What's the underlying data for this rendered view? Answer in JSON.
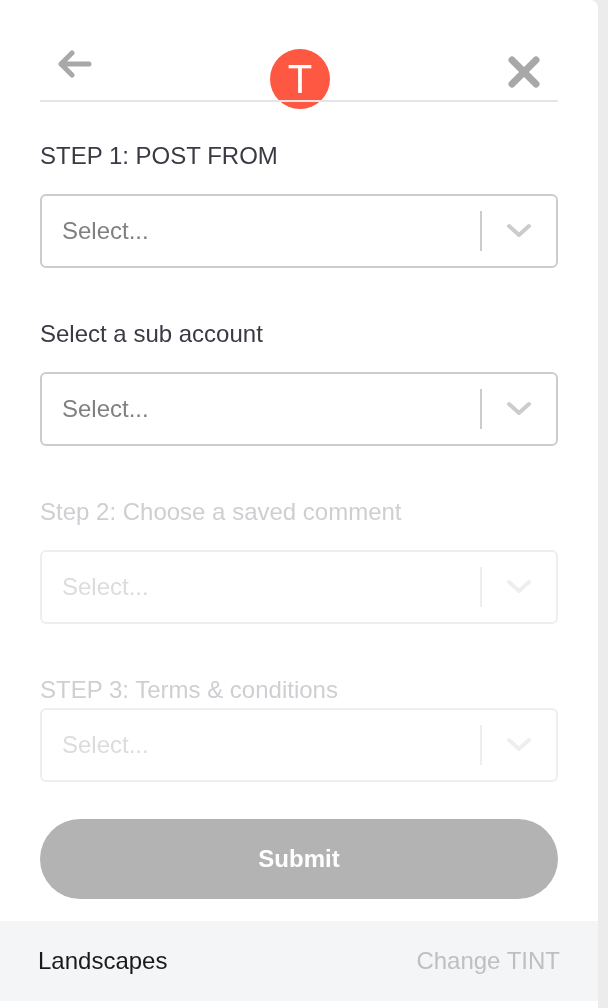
{
  "header": {
    "logo": "T"
  },
  "fields": [
    {
      "label": "STEP 1: POST FROM",
      "placeholder": "Select...",
      "disabled": false
    },
    {
      "label": "Select a sub account",
      "placeholder": "Select...",
      "disabled": false
    },
    {
      "label": "Step 2: Choose a saved comment",
      "placeholder": "Select...",
      "disabled": true
    },
    {
      "label": "STEP 3: Terms & conditions",
      "placeholder": "Select...",
      "disabled": true
    }
  ],
  "submit": {
    "label": "Submit",
    "disabled": true
  },
  "footer": {
    "title": "Landscapes",
    "link": "Change TINT"
  }
}
